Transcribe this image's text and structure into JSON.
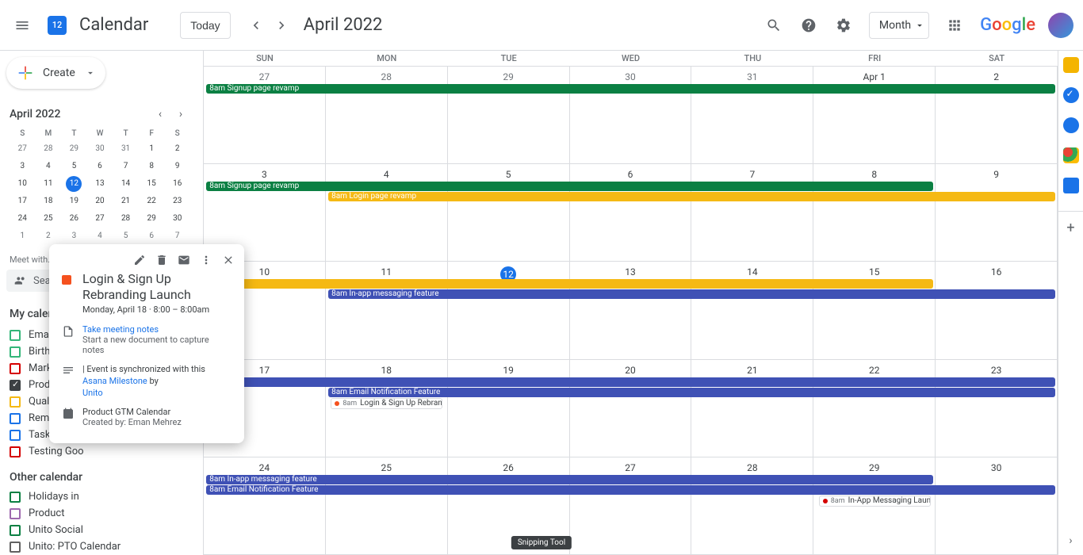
{
  "header": {
    "app_name": "Calendar",
    "today_label": "Today",
    "date_label": "April 2022",
    "view_label": "Month"
  },
  "create_label": "Create",
  "mini_cal": {
    "title": "April 2022",
    "dow": [
      "S",
      "M",
      "T",
      "W",
      "T",
      "F",
      "S"
    ],
    "rows": [
      [
        "27",
        "28",
        "29",
        "30",
        "31",
        "1",
        "2"
      ],
      [
        "3",
        "4",
        "5",
        "6",
        "7",
        "8",
        "9"
      ],
      [
        "10",
        "11",
        "12",
        "13",
        "14",
        "15",
        "16"
      ],
      [
        "17",
        "18",
        "19",
        "20",
        "21",
        "22",
        "23"
      ],
      [
        "24",
        "25",
        "26",
        "27",
        "28",
        "29",
        "30"
      ],
      [
        "1",
        "2",
        "3",
        "4",
        "5",
        "6",
        "7"
      ]
    ],
    "today": "12"
  },
  "meet_with_label": "Meet with...",
  "search_placeholder": "Search for people",
  "my_calendars_label": "My calendars",
  "my_calendars": [
    {
      "label": "Eman Mehrez",
      "color": "#33b679",
      "checked": false
    },
    {
      "label": "Birthdays",
      "color": "#33b679",
      "checked": false
    },
    {
      "label": "Marketing A",
      "color": "#d50000",
      "checked": false
    },
    {
      "label": "Product GTM",
      "color": "#3c4043",
      "checked": true
    },
    {
      "label": "Quality Rota",
      "color": "#f5b914",
      "checked": false
    },
    {
      "label": "Reminders",
      "color": "#1a73e8",
      "checked": false
    },
    {
      "label": "Tasks",
      "color": "#1a73e8",
      "checked": false
    },
    {
      "label": "Testing Goo",
      "color": "#d50000",
      "checked": false
    }
  ],
  "other_calendars_label": "Other calendar",
  "other_calendars": [
    {
      "label": "Holidays in",
      "color": "#0b8043",
      "checked": false
    },
    {
      "label": "Product",
      "color": "#9e69af",
      "checked": false
    },
    {
      "label": "Unito Social",
      "color": "#0b8043",
      "checked": false
    },
    {
      "label": "Unito: PTO Calendar",
      "color": "#616161",
      "checked": false
    }
  ],
  "grid": {
    "dow": [
      "SUN",
      "MON",
      "TUE",
      "WED",
      "THU",
      "FRI",
      "SAT"
    ],
    "weeks": [
      {
        "days": [
          "27",
          "28",
          "29",
          "30",
          "31",
          "Apr 1",
          "2"
        ],
        "muted": [
          0,
          1,
          2,
          3,
          4
        ]
      },
      {
        "days": [
          "3",
          "4",
          "5",
          "6",
          "7",
          "8",
          "9"
        ]
      },
      {
        "days": [
          "10",
          "11",
          "12",
          "13",
          "14",
          "15",
          "16"
        ],
        "today": 2
      },
      {
        "days": [
          "17",
          "18",
          "19",
          "20",
          "21",
          "22",
          "23"
        ]
      },
      {
        "days": [
          "24",
          "25",
          "26",
          "27",
          "28",
          "29",
          "30"
        ]
      }
    ]
  },
  "events": {
    "w0_signup": "8am  Signup page revamp",
    "w1_signup": "8am  Signup page revamp",
    "w1_login": "8am  Login page revamp",
    "w2_inapp": "8am  In-app messaging feature",
    "w3_inapp": "",
    "w3_email": "8am  Email Notification Feature",
    "w3_launch_time": "8am",
    "w3_launch": "Login & Sign Up Rebranding Launch",
    "w4_inapp": "8am  In-app messaging feature",
    "w4_email": "8am  Email Notification Feature",
    "w4_launch_time": "8am",
    "w4_launch": "In-App Messaging Launch"
  },
  "popup": {
    "title": "Login & Sign Up Rebranding Launch",
    "subtitle": "Monday, April 18  ·  8:00 – 8:00am",
    "notes_link": "Take meeting notes",
    "notes_sub": "Start a new document to capture notes",
    "sync_prefix": "| Event is synchronized with this ",
    "sync_link": "Asana Milestone",
    "sync_by": " by ",
    "sync_unito": "Unito",
    "cal_name": "Product GTM Calendar",
    "created_by": "Created by: Eman Mehrez"
  },
  "snip": "Snipping Tool"
}
